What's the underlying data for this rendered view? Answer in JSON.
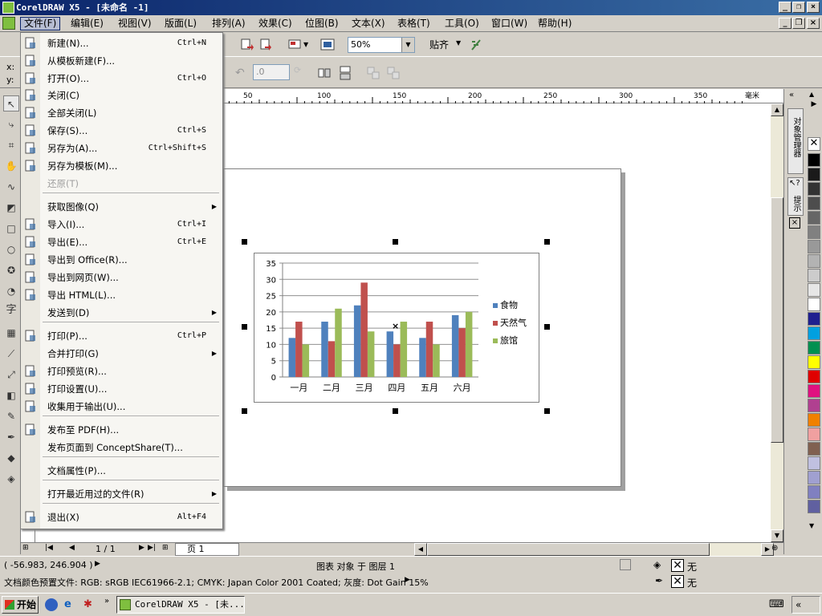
{
  "window": {
    "title": "CorelDRAW X5 - [未命名 -1]"
  },
  "menubar": {
    "items": [
      {
        "label": "文件(F)",
        "active": true
      },
      {
        "label": "编辑(E)"
      },
      {
        "label": "视图(V)"
      },
      {
        "label": "版面(L)"
      },
      {
        "label": "排列(A)"
      },
      {
        "label": "效果(C)"
      },
      {
        "label": "位图(B)"
      },
      {
        "label": "文本(X)"
      },
      {
        "label": "表格(T)"
      },
      {
        "label": "工具(O)"
      },
      {
        "label": "窗口(W)"
      },
      {
        "label": "帮助(H)"
      }
    ]
  },
  "toolbar": {
    "zoom_value": "50%",
    "snap_label": "贴齐",
    "rotate_value": ".0",
    "x_label": "x:",
    "y_label": "y:"
  },
  "ruler": {
    "unit": "毫米",
    "ticks": [
      "50",
      "100",
      "150",
      "200",
      "250",
      "300",
      "350"
    ]
  },
  "file_menu": {
    "items": [
      {
        "label": "新建(N)...",
        "shortcut": "Ctrl+N",
        "icon": "new-doc-icon"
      },
      {
        "label": "从模板新建(F)...",
        "shortcut": "",
        "icon": "template-icon"
      },
      {
        "label": "打开(O)...",
        "shortcut": "Ctrl+O",
        "icon": "open-folder-icon"
      },
      {
        "label": "关闭(C)",
        "shortcut": "",
        "icon": "close-doc-icon"
      },
      {
        "label": "全部关闭(L)",
        "shortcut": "",
        "icon": "close-all-icon"
      },
      {
        "label": "保存(S)...",
        "shortcut": "Ctrl+S",
        "icon": "save-icon"
      },
      {
        "label": "另存为(A)...",
        "shortcut": "Ctrl+Shift+S",
        "icon": "save-as-icon"
      },
      {
        "label": "另存为模板(M)...",
        "shortcut": "",
        "icon": "save-template-icon"
      },
      {
        "label": "还原(T)",
        "shortcut": "",
        "icon": "",
        "disabled": true
      },
      {
        "label": "获取图像(Q)",
        "shortcut": "",
        "icon": "",
        "submenu": true
      },
      {
        "label": "导入(I)...",
        "shortcut": "Ctrl+I",
        "icon": "import-icon"
      },
      {
        "label": "导出(E)...",
        "shortcut": "Ctrl+E",
        "icon": "export-icon"
      },
      {
        "label": "导出到 Office(R)...",
        "shortcut": "",
        "icon": "export-office-icon"
      },
      {
        "label": "导出到网页(W)...",
        "shortcut": "",
        "icon": "export-web-icon"
      },
      {
        "label": "导出 HTML(L)...",
        "shortcut": "",
        "icon": "export-html-icon"
      },
      {
        "label": "发送到(D)",
        "shortcut": "",
        "icon": "",
        "submenu": true
      },
      {
        "label": "打印(P)...",
        "shortcut": "Ctrl+P",
        "icon": "print-icon"
      },
      {
        "label": "合并打印(G)",
        "shortcut": "",
        "icon": "",
        "submenu": true
      },
      {
        "label": "打印预览(R)...",
        "shortcut": "",
        "icon": "print-preview-icon"
      },
      {
        "label": "打印设置(U)...",
        "shortcut": "",
        "icon": "print-setup-icon"
      },
      {
        "label": "收集用于输出(U)...",
        "shortcut": "",
        "icon": "collect-output-icon"
      },
      {
        "label": "发布至 PDF(H)...",
        "shortcut": "",
        "icon": "pdf-icon"
      },
      {
        "label": "发布页面到 ConceptShare(T)...",
        "shortcut": "",
        "icon": ""
      },
      {
        "label": "文档属性(P)...",
        "shortcut": "",
        "icon": ""
      },
      {
        "label": "打开最近用过的文件(R)",
        "shortcut": "",
        "icon": "",
        "submenu": true
      },
      {
        "label": "退出(X)",
        "shortcut": "Alt+F4",
        "icon": "exit-icon"
      }
    ]
  },
  "chart_data": {
    "type": "bar",
    "categories": [
      "一月",
      "二月",
      "三月",
      "四月",
      "五月",
      "六月"
    ],
    "series": [
      {
        "name": "食物",
        "values": [
          12,
          17,
          22,
          14,
          12,
          19
        ],
        "color": "#4f81bd"
      },
      {
        "name": "天然气",
        "values": [
          17,
          11,
          29,
          10,
          17,
          15
        ],
        "color": "#c0504d"
      },
      {
        "name": "旅馆",
        "values": [
          10,
          21,
          14,
          17,
          10,
          20
        ],
        "color": "#9bbb59"
      }
    ],
    "ylim": [
      0,
      35
    ],
    "yticks": [
      "0",
      "5",
      "10",
      "15",
      "20",
      "25",
      "30",
      "35"
    ],
    "legend": "right",
    "grid": true
  },
  "bottom_nav": {
    "page_count": "1 / 1",
    "page_tab": "页 1"
  },
  "status": {
    "coords": "( -56.983, 246.904 )",
    "selection": "图表 对象 于 图层 1",
    "color_profile": "文档颜色预置文件: RGB: sRGB IEC61966-2.1; CMYK: Japan Color 2001 Coated; 灰度: Dot Gain 15%",
    "fill": "无",
    "outline": "无"
  },
  "docker": {
    "tab1": "对象管理器",
    "tab2": "提示"
  },
  "palette": [
    "#ffffff",
    "#000000",
    "#1a1a1a",
    "#333333",
    "#4d4d4d",
    "#666666",
    "#808080",
    "#999999",
    "#b3b3b3",
    "#cccccc",
    "#e6e6e6",
    "#ffffff",
    "#1f1f8f",
    "#00a0e0",
    "#009050",
    "#ffff00",
    "#e00000",
    "#e01080",
    "#b04090",
    "#f08000",
    "#f0a0a0",
    "#806050",
    "#c0c0e0",
    "#a0a0d0",
    "#8080c0",
    "#6060a0"
  ],
  "taskbar": {
    "start": "开始",
    "task_item": "CorelDRAW X5 - [未..."
  }
}
